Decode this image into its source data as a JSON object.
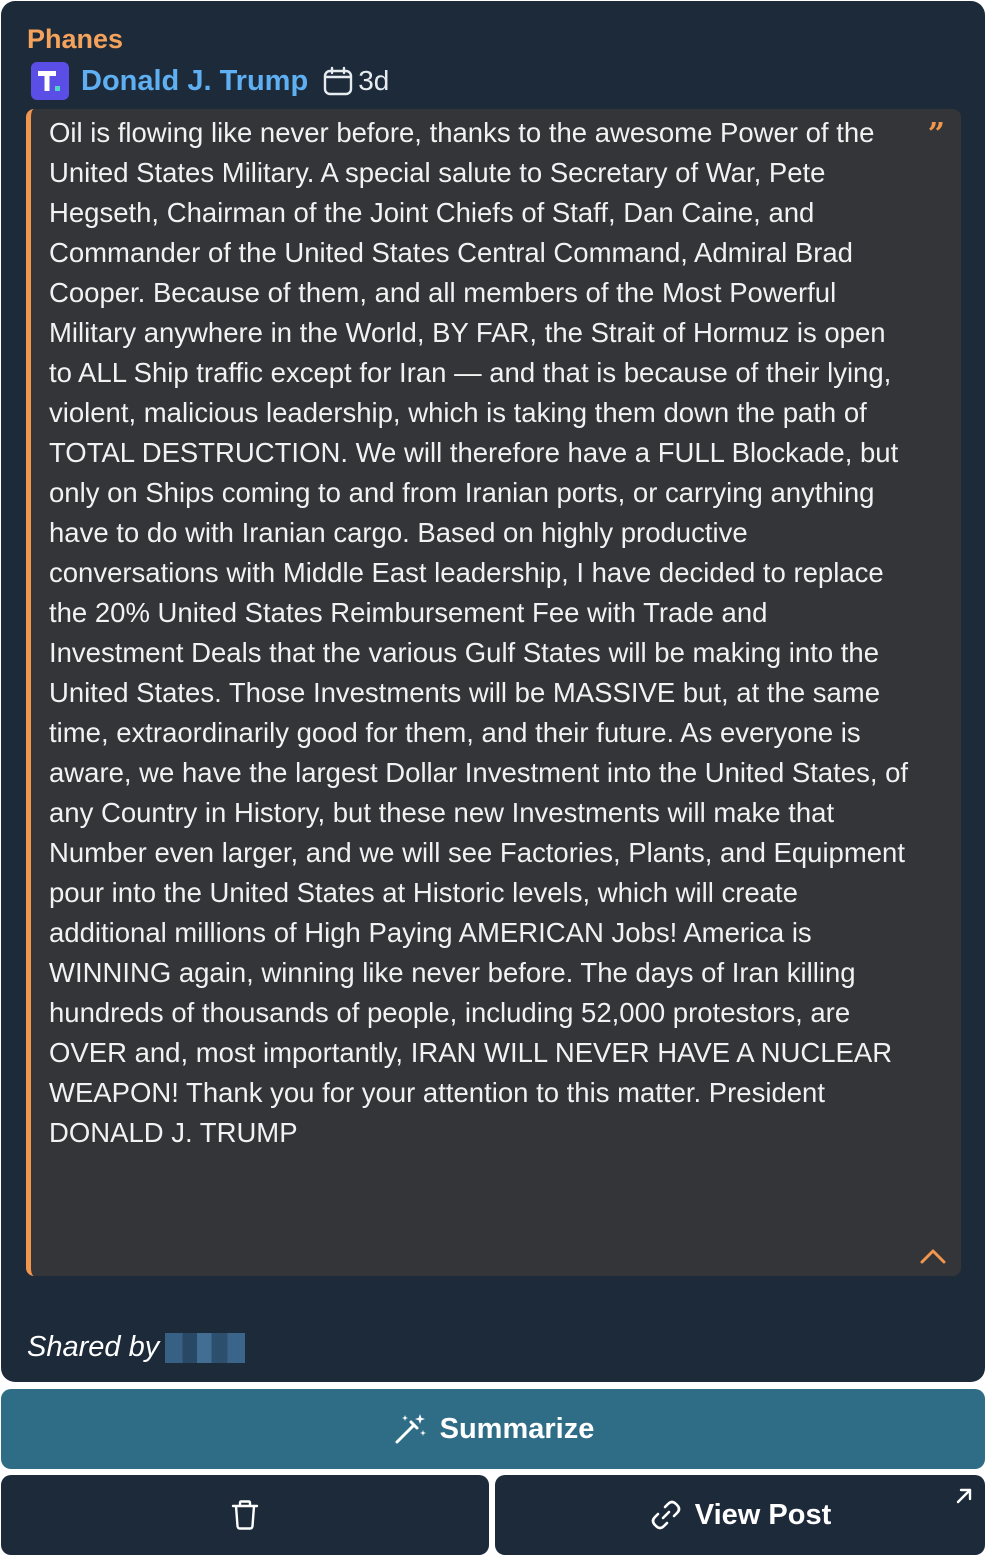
{
  "card": {
    "source_name": "Phanes",
    "author_name": "Donald J. Trump",
    "post_age": "3d",
    "post_text": "Oil is flowing like never before, thanks to the awesome Power of the United States Military. A special salute to Secretary of War, Pete Hegseth, Chairman of the Joint Chiefs of Staff, Dan Caine, and Commander of the United States Central Command, Admiral Brad Cooper. Because of them, and all members of the Most Powerful Military anywhere in the World, BY FAR, the Strait of Hormuz is open to ALL Ship traffic except for Iran — and that is because of their lying, violent, malicious leadership, which is taking them down the path of TOTAL DESTRUCTION. We will therefore have a FULL Blockade, but only on Ships coming to and from Iranian ports, or carrying anything have to do with Iranian cargo. Based on highly productive conversations with Middle East leadership, I have decided to replace the 20% United States Reimbursement Fee with Trade and Investment Deals that the various Gulf States will be making into the United States. Those Investments will be MASSIVE but, at the same time, extraordinarily good for them, and their future. As everyone is aware, we have the largest Dollar Investment into the United States, of any Country in History, but these new Investments will make that Number even larger, and we will see Factories, Plants, and Equipment pour into the United States at Historic levels, which will create additional millions of High Paying AMERICAN Jobs! America is WINNING again, winning like never before. The days of Iran killing hundreds of thousands of people, including 52,000 protestors, are OVER and, most importantly, IRAN WILL NEVER HAVE A NUCLEAR WEAPON! Thank you for your attention to this matter. President DONALD J. TRUMP",
    "shared_label": "Shared by"
  },
  "actions": {
    "summarize_label": "Summarize",
    "view_post_label": "View Post"
  },
  "icons": {
    "platform": "truth-social-icon",
    "date": "calendar-icon",
    "quote": "quote-icon",
    "collapse": "chevron-up-icon",
    "summarize": "magic-wand-icon",
    "delete": "trash-icon",
    "view": "link-icon",
    "external": "external-link-icon"
  },
  "colors": {
    "card_bg": "#1d2a3a",
    "source_name": "#f5a35c",
    "author_name": "#5fb0f2",
    "accent": "#f0964e",
    "summarize_bg": "#2f6d86",
    "quote_bg": "#333538"
  }
}
